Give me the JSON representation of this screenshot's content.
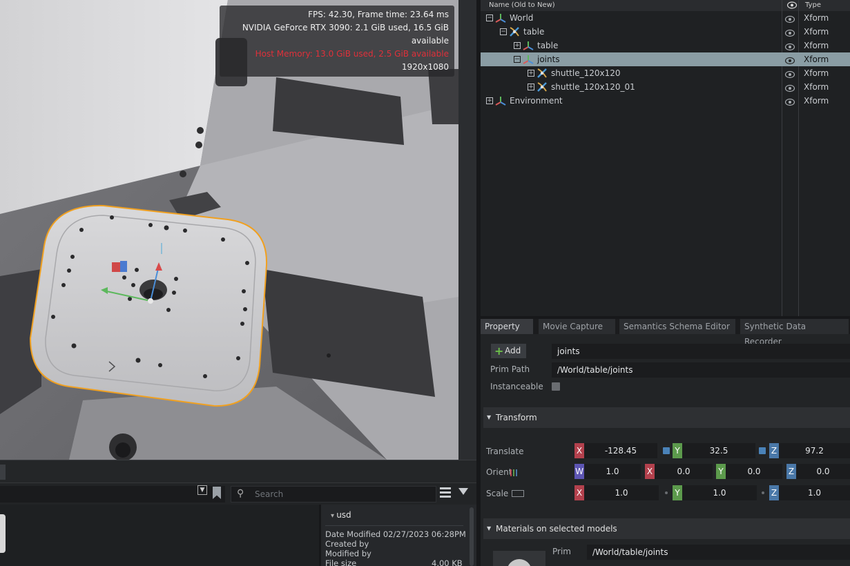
{
  "viewport": {
    "hud": {
      "fps": "FPS: 42.30, Frame time: 23.64 ms",
      "gpu": "NVIDIA GeForce RTX 3090: 2.1 GiB used, 16.5 GiB available",
      "host_memory": "Host Memory: 13.0 GiB used, 2.5 GiB available",
      "resolution": "1920x1080"
    },
    "colors": {
      "selection_outline": "#f0a020",
      "warning": "#e0303a"
    }
  },
  "stage": {
    "header": {
      "name": "Name (Old to New)",
      "visibility_icon": "eye-icon",
      "type": "Type"
    },
    "rows": [
      {
        "label": "World",
        "type": "Xform",
        "expander": "−",
        "icon": "xform-icon",
        "selected": false
      },
      {
        "label": "table",
        "type": "Xform",
        "expander": "−",
        "icon": "joint-icon",
        "selected": false
      },
      {
        "label": "table",
        "type": "Xform",
        "expander": "+",
        "icon": "xform-icon",
        "selected": false
      },
      {
        "label": "joints",
        "type": "Xform",
        "expander": "−",
        "icon": "xform-icon",
        "selected": true
      },
      {
        "label": "shuttle_120x120",
        "type": "Xform",
        "expander": "+",
        "icon": "joint-icon",
        "selected": false
      },
      {
        "label": "shuttle_120x120_01",
        "type": "Xform",
        "expander": "+",
        "icon": "joint-icon",
        "selected": false
      },
      {
        "label": "Environment",
        "type": "Xform",
        "expander": "+",
        "icon": "xform-icon",
        "selected": false
      }
    ]
  },
  "property": {
    "tabs": [
      "Property",
      "Movie Capture",
      "Semantics Schema Editor",
      "Synthetic Data Recorder"
    ],
    "active_tab": "Property",
    "add_label": "Add",
    "name_value": "joints",
    "prim_path_label": "Prim Path",
    "prim_path_value": "/World/table/joints",
    "instanceable_label": "Instanceable",
    "instanceable_checked": false,
    "transform": {
      "title": "Transform",
      "translate": {
        "label": "Translate",
        "x": "-128.45",
        "y": "32.5",
        "z": "97.2"
      },
      "orient": {
        "label": "Orient",
        "w": "1.0",
        "x": "0.0",
        "y": "0.0",
        "z": "0.0"
      },
      "scale": {
        "label": "Scale",
        "x": "1.0",
        "y": "1.0",
        "z": "1.0"
      }
    },
    "materials": {
      "title": "Materials on selected models",
      "prim_label": "Prim",
      "prim_value": "/World/table/joints"
    }
  },
  "content_browser": {
    "search_placeholder": "Search",
    "detail": {
      "header": "usd",
      "date_modified": "Date Modified 02/27/2023 06:28PM",
      "created_by": "Created by",
      "modified_by": "Modified by",
      "file_size_label": "File size",
      "file_size_value": "4.00 KB"
    }
  }
}
